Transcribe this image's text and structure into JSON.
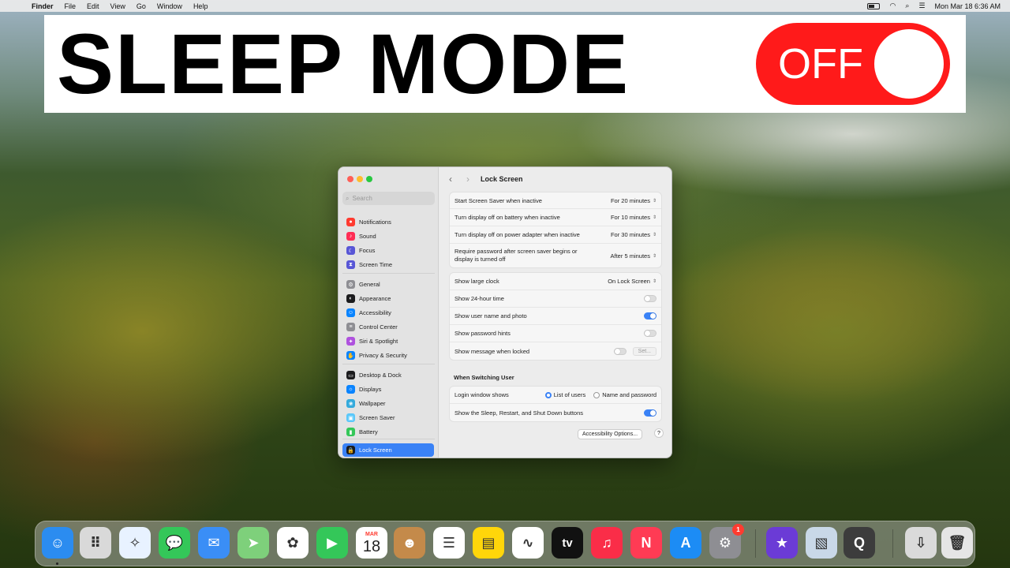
{
  "menubar": {
    "app": "Finder",
    "items": [
      "File",
      "Edit",
      "View",
      "Go",
      "Window",
      "Help"
    ],
    "clock": "Mon Mar 18  6:36 AM"
  },
  "banner": {
    "title": "SLEEP MODE",
    "toggle_label": "OFF",
    "toggle_color": "#ff1a1a"
  },
  "window": {
    "title": "Lock Screen",
    "search_placeholder": "Search",
    "sidebar": [
      {
        "label": "Notifications",
        "icon": "bell-icon",
        "color": "#ff3b30"
      },
      {
        "label": "Sound",
        "icon": "speaker-icon",
        "color": "#ff2d55"
      },
      {
        "label": "Focus",
        "icon": "moon-icon",
        "color": "#5856d6"
      },
      {
        "label": "Screen Time",
        "icon": "hourglass-icon",
        "color": "#5856d6"
      },
      {
        "label": "General",
        "icon": "gear-icon",
        "color": "#8e8e93"
      },
      {
        "label": "Appearance",
        "icon": "appearance-icon",
        "color": "#1c1c1e"
      },
      {
        "label": "Accessibility",
        "icon": "accessibility-icon",
        "color": "#0a84ff"
      },
      {
        "label": "Control Center",
        "icon": "control-center-icon",
        "color": "#8e8e93"
      },
      {
        "label": "Siri & Spotlight",
        "icon": "siri-icon",
        "color": "#af52de"
      },
      {
        "label": "Privacy & Security",
        "icon": "hand-icon",
        "color": "#0a84ff"
      },
      {
        "label": "Desktop & Dock",
        "icon": "dock-icon",
        "color": "#1c1c1e"
      },
      {
        "label": "Displays",
        "icon": "display-icon",
        "color": "#0a84ff"
      },
      {
        "label": "Wallpaper",
        "icon": "wallpaper-icon",
        "color": "#34aadc"
      },
      {
        "label": "Screen Saver",
        "icon": "screensaver-icon",
        "color": "#5ac8fa"
      },
      {
        "label": "Battery",
        "icon": "battery-icon",
        "color": "#34c759"
      },
      {
        "label": "Lock Screen",
        "icon": "lock-icon",
        "color": "#1c1c1e",
        "active": true
      }
    ],
    "group1": [
      {
        "label": "Start Screen Saver when inactive",
        "value": "For 20 minutes"
      },
      {
        "label": "Turn display off on battery when inactive",
        "value": "For 10 minutes"
      },
      {
        "label": "Turn display off on power adapter when inactive",
        "value": "For 30 minutes"
      },
      {
        "label": "Require password after screen saver begins or display is turned off",
        "value": "After 5 minutes"
      }
    ],
    "group2": {
      "large_clock": {
        "label": "Show large clock",
        "value": "On Lock Screen"
      },
      "hour24": {
        "label": "Show 24-hour time",
        "on": false
      },
      "user_photo": {
        "label": "Show user name and photo",
        "on": true
      },
      "pw_hints": {
        "label": "Show password hints",
        "on": false
      },
      "message": {
        "label": "Show message when locked",
        "on": false,
        "button": "Set..."
      }
    },
    "switching": {
      "title": "When Switching User",
      "login_label": "Login window shows",
      "option_list": "List of users",
      "option_name": "Name and password",
      "selected": "List of users",
      "sleep_buttons": {
        "label": "Show the Sleep, Restart, and Shut Down buttons",
        "on": true
      }
    },
    "accessibility_button": "Accessibility Options...",
    "help_button": "?"
  },
  "dock": {
    "calendar_month": "MAR",
    "calendar_day": "18",
    "tv_label": "tv",
    "settings_badge": "1",
    "apps": [
      {
        "name": "finder-icon",
        "color": "#2b8cf0"
      },
      {
        "name": "launchpad-icon",
        "color": "#d9d9d9"
      },
      {
        "name": "safari-icon",
        "color": "#e8f2ff"
      },
      {
        "name": "messages-icon",
        "color": "#34c759"
      },
      {
        "name": "mail-icon",
        "color": "#3a8ef6"
      },
      {
        "name": "maps-icon",
        "color": "#7ed07b"
      },
      {
        "name": "photos-icon",
        "color": "#ffffff"
      },
      {
        "name": "facetime-icon",
        "color": "#34c759"
      },
      {
        "name": "calendar-icon",
        "color": "#ffffff"
      },
      {
        "name": "contacts-icon",
        "color": "#c48a4a"
      },
      {
        "name": "reminders-icon",
        "color": "#ffffff"
      },
      {
        "name": "notes-icon",
        "color": "#ffd60a"
      },
      {
        "name": "freeform-icon",
        "color": "#ffffff"
      },
      {
        "name": "tv-icon",
        "color": "#111111"
      },
      {
        "name": "music-icon",
        "color": "#fa2d48"
      },
      {
        "name": "news-icon",
        "color": "#ff3b54"
      },
      {
        "name": "app-store-icon",
        "color": "#1c8cf5"
      },
      {
        "name": "system-settings-icon",
        "color": "#8e8e93"
      },
      {
        "name": "imovie-icon",
        "color": "#6b3bd6"
      },
      {
        "name": "preview-icon",
        "color": "#c9d8e8"
      },
      {
        "name": "quicktime-icon",
        "color": "#3c3c3c"
      },
      {
        "name": "downloads-icon",
        "color": "#dadada"
      },
      {
        "name": "trash-icon",
        "color": "#e5e5e5"
      }
    ]
  }
}
